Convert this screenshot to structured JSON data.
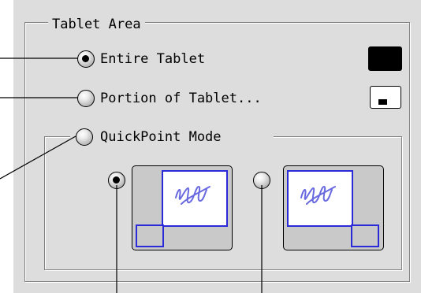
{
  "group": {
    "title": "Tablet Area"
  },
  "options": {
    "entire": {
      "label": "Entire Tablet",
      "selected": true
    },
    "portion": {
      "label": "Portion of Tablet...",
      "selected": false
    },
    "quickpoint": {
      "label": "QuickPoint Mode",
      "selected": false
    }
  },
  "quickpoint_choices": {
    "left": {
      "corner": "bottom-left",
      "selected": true
    },
    "right": {
      "corner": "bottom-right",
      "selected": false
    }
  },
  "colors": {
    "panel_bg": "#dddddd",
    "thumb_bg": "#c9c9c9",
    "accent_blue": "#2a2ad8",
    "scribble": "#6a6ae0"
  }
}
